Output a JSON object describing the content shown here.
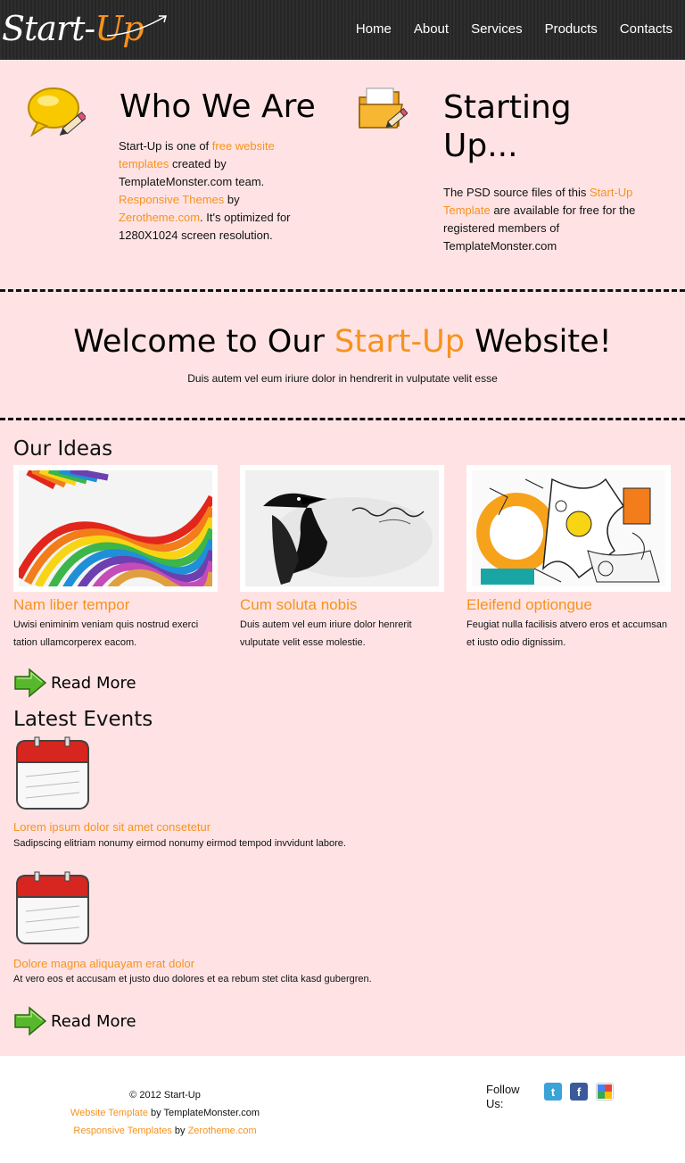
{
  "logo": {
    "part1": "Start-",
    "part2": "Up"
  },
  "nav": [
    "Home",
    "About",
    "Services",
    "Products",
    "Contacts"
  ],
  "who": {
    "title": "Who We Are",
    "t1": "Start-Up is one of ",
    "l1": "free website templates",
    "t2": " created by TemplateMonster.com team. ",
    "l2": "Responsive Themes",
    "t3": " by ",
    "l3": "Zerotheme.com",
    "t4": ". It's optimized for 1280X1024 screen resolution."
  },
  "starting": {
    "title": "Starting Up...",
    "t1": "The PSD source files of this ",
    "l1": "Start-Up Template",
    "t2": " are available for free for the registered members of TemplateMonster.com"
  },
  "welcome": {
    "pre": "Welcome to Our ",
    "accent": "Start-Up",
    "post": " Website!",
    "sub": "Duis autem vel eum iriure dolor in hendrerit in vulputate velit esse"
  },
  "ideas": {
    "title": "Our Ideas",
    "items": [
      {
        "title": "Nam liber tempor",
        "text": "Uwisi eniminim veniam quis nostrud exerci tation ullamcorperex eacom."
      },
      {
        "title": "Cum soluta nobis",
        "text": "Duis autem vel eum iriure dolor henrerit vulputate velit esse molestie."
      },
      {
        "title": "Eleifend optiongue",
        "text": "Feugiat nulla facilisis atvero eros et accumsan et iusto odio dignissim."
      }
    ],
    "readmore": "Read More"
  },
  "events": {
    "title": "Latest Events",
    "items": [
      {
        "title": "Lorem ipsum dolor sit amet consetetur",
        "text": "Sadipscing elitriam nonumy eirmod nonumy eirmod tempod invvidunt labore."
      },
      {
        "title": "Dolore magna aliquayam erat dolor",
        "text": "At vero eos et accusam et justo duo dolores et ea rebum stet clita kasd gubergren."
      }
    ],
    "readmore": "Read More"
  },
  "footer": {
    "copy": "© 2012 Start-Up",
    "l1": "Website Template",
    "t1": " by TemplateMonster.com",
    "l2": "Responsive Templates",
    "t2": " by ",
    "l3": "Zerotheme.com",
    "follow": "Follow Us:"
  },
  "colors": {
    "accent": "#f7921e",
    "bg": "#ffe3e4",
    "header": "#2b2b2b"
  },
  "icons": [
    "chat-bubble-pencil-icon",
    "folder-pencil-icon",
    "arrow-right-icon",
    "calendar-icon",
    "twitter-icon",
    "facebook-icon",
    "google-icon"
  ]
}
